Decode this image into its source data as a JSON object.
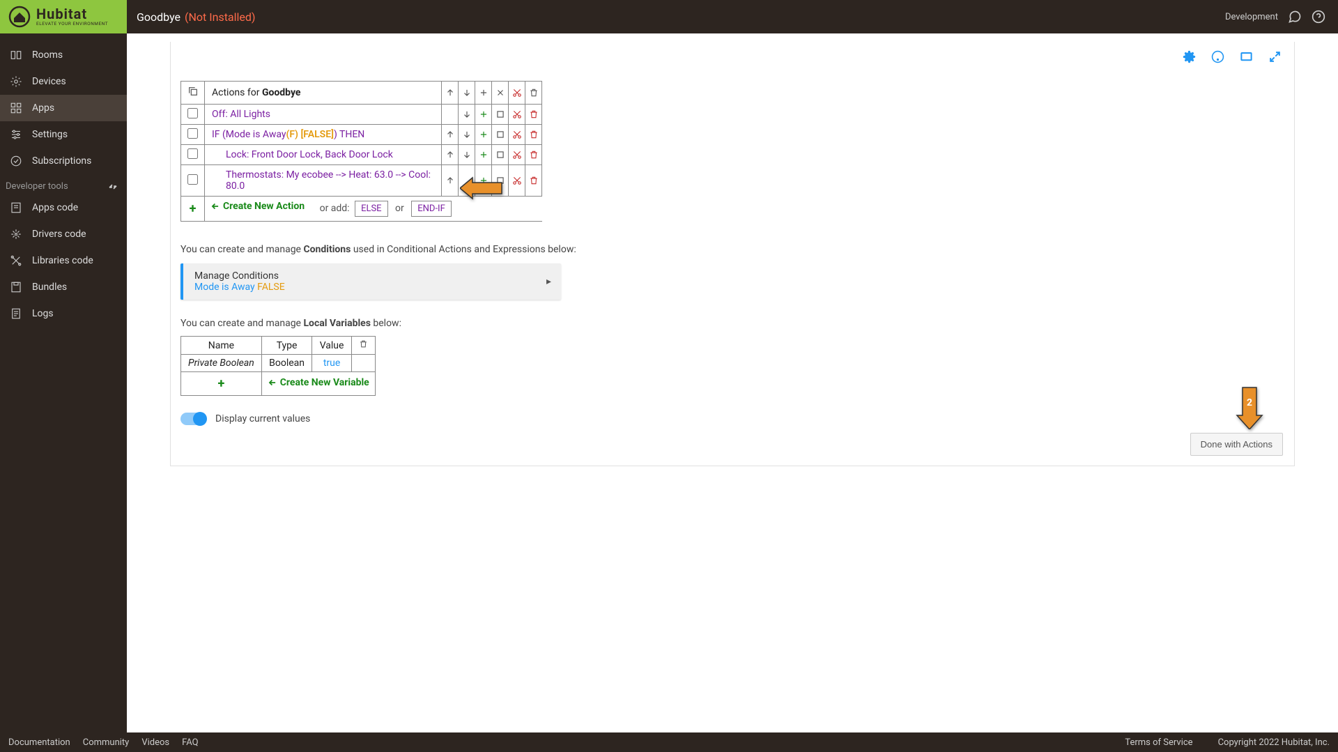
{
  "brand": {
    "name": "Hubitat",
    "tagline": "ELEVATE YOUR ENVIRONMENT"
  },
  "header": {
    "title": "Goodbye",
    "status": "(Not Installed)",
    "devmode": "Development"
  },
  "sidebar": {
    "items": [
      "Rooms",
      "Devices",
      "Apps",
      "Settings",
      "Subscriptions"
    ],
    "devSection": "Developer tools",
    "devItems": [
      "Apps code",
      "Drivers code",
      "Libraries code",
      "Bundles",
      "Logs"
    ]
  },
  "actions": {
    "tableTitlePrefix": "Actions for ",
    "tableTitleBold": "Goodbye",
    "rows": [
      {
        "text": "Off: All Lights",
        "indent": 0
      },
      {
        "ifPrefix": "IF (Mode is Away",
        "ifF": "(F)",
        "ifFalse": " [FALSE]",
        "ifSuffix": ") THEN",
        "indent": 0
      },
      {
        "text": "Lock: Front Door Lock, Back Door Lock",
        "indent": 1
      },
      {
        "text": "Thermostats: My ecobee --> Heat: 63.0 --> Cool: 80.0",
        "indent": 1
      }
    ],
    "createNew": "Create New Action",
    "orAdd": "or add:",
    "else": "ELSE",
    "orSep": "or",
    "endif": "END-IF"
  },
  "conditions": {
    "intro1": "You can create and manage ",
    "introBold": "Conditions",
    "intro2": " used in Conditional Actions and Expressions below:",
    "boxTitle": "Manage Conditions",
    "boxDetail": "Mode is Away ",
    "boxFalse": "FALSE"
  },
  "localVars": {
    "intro1": "You can create and manage ",
    "introBold": "Local Variables",
    "intro2": " below:",
    "headers": {
      "name": "Name",
      "type": "Type",
      "value": "Value"
    },
    "row": {
      "name": "Private Boolean",
      "type": "Boolean",
      "value": "true"
    },
    "createNew": "Create New Variable"
  },
  "toggle": {
    "label": "Display current values"
  },
  "doneBtn": "Done with Actions",
  "calloutNum": "2",
  "footer": {
    "links": [
      "Documentation",
      "Community",
      "Videos",
      "FAQ"
    ],
    "terms": "Terms of Service",
    "copyright": "Copyright 2022 Hubitat, Inc."
  }
}
